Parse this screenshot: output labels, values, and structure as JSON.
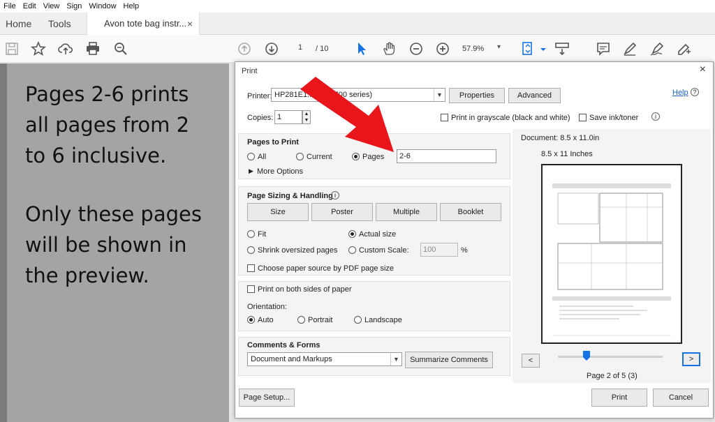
{
  "menu": [
    "File",
    "Edit",
    "View",
    "Sign",
    "Window",
    "Help"
  ],
  "tabs": {
    "home": "Home",
    "tools": "Tools",
    "document": "Avon tote bag instr...",
    "close": "×"
  },
  "toolbar": {
    "current_page": "1",
    "page_total": "/ 10",
    "zoom": "57.9%"
  },
  "annotation": {
    "para1": "Pages 2-6 prints\nall pages from 2\nto 6 inclusive.",
    "para2": "Only these pages\nwill be shown in\nthe preview."
  },
  "dialog": {
    "title": "Print",
    "close": "×",
    "printer_label": "Printer:",
    "printer_value": "HP281E1...kJet 2700 series)",
    "properties_button": "Properties",
    "advanced_button": "Advanced",
    "help_link": "Help",
    "copies_label": "Copies:",
    "copies_value": "1",
    "grayscale_label": "Print in grayscale (black and white)",
    "saveink_label": "Save ink/toner",
    "pages_to_print": {
      "heading": "Pages to Print",
      "all": "All",
      "current": "Current",
      "pages": "Pages",
      "range_value": "2-6",
      "more_options": "More Options"
    },
    "sizing": {
      "heading": "Page Sizing & Handling",
      "size": "Size",
      "poster": "Poster",
      "multiple": "Multiple",
      "booklet": "Booklet",
      "fit": "Fit",
      "actual_size": "Actual size",
      "shrink": "Shrink oversized pages",
      "custom_scale": "Custom Scale:",
      "scale_value": "100",
      "percent": "%",
      "choose_source": "Choose paper source by PDF page size"
    },
    "both_sides": "Print on both sides of paper",
    "orientation": {
      "label": "Orientation:",
      "auto": "Auto",
      "portrait": "Portrait",
      "landscape": "Landscape"
    },
    "comments": {
      "heading": "Comments & Forms",
      "value": "Document and Markups",
      "summarize": "Summarize Comments"
    },
    "preview": {
      "document_size": "Document: 8.5 x 11.0in",
      "paper_size": "8.5 x 11 Inches",
      "page_info": "Page 2 of 5 (3)",
      "prev": "<",
      "next": ">"
    },
    "page_setup": "Page Setup...",
    "print_button": "Print",
    "cancel_button": "Cancel"
  },
  "colors": {
    "accent": "#1473e6",
    "arrow": "#e8151b"
  }
}
